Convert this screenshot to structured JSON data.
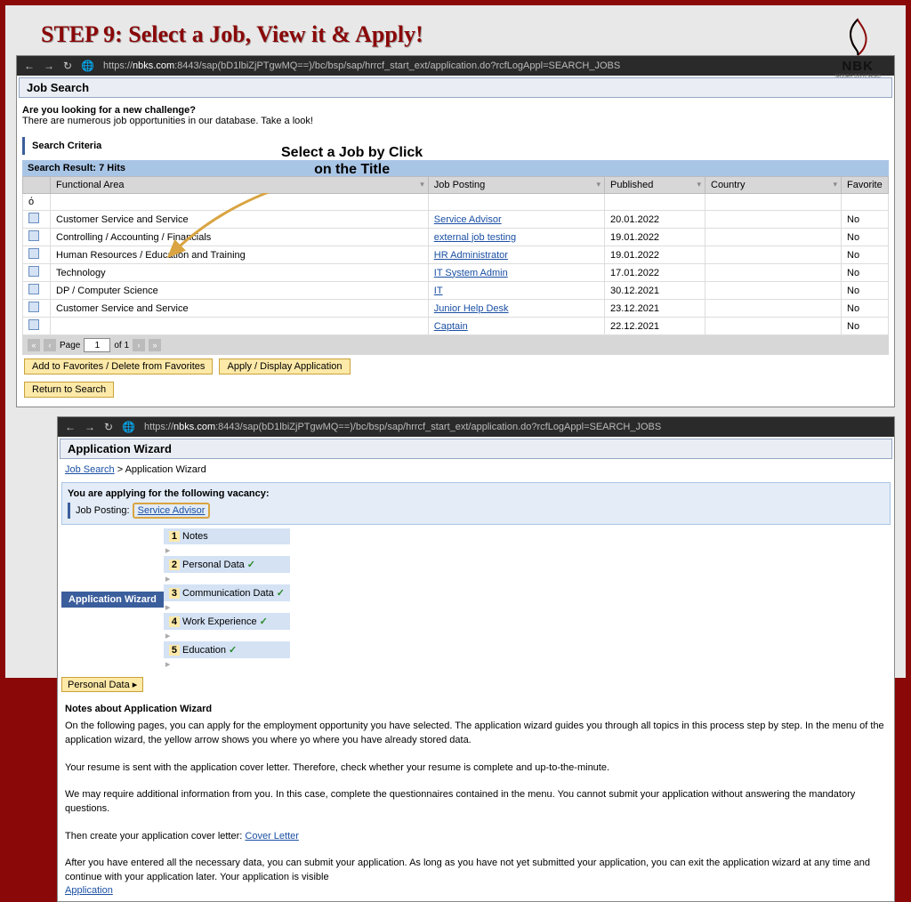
{
  "title": "STEP 9: Select a Job, View it & Apply!",
  "logo": {
    "text": "NBK",
    "sub": "NASSER BIN KHALED"
  },
  "annot": {
    "line1": "Select a Job by Click",
    "line2": "on the Title"
  },
  "browser": {
    "url_pre": "https://",
    "url_dom": "nbks.com",
    "url_post": ":8443/sap(bD1lbiZjPTgwMQ==)/bc/bsp/sap/hrrcf_start_ext/application.do?rcfLogAppl=SEARCH_JOBS"
  },
  "search": {
    "title": "Job Search",
    "q": "Are you looking for a new challenge?",
    "sub": "There are numerous job opportunities in our database. Take a look!",
    "criteria": "Search Criteria",
    "result": "Search Result: 7 Hits",
    "cols": {
      "fa": "Functional Area",
      "jp": "Job Posting",
      "pub": "Published",
      "cty": "Country",
      "fav": "Favorite"
    },
    "rows": [
      {
        "fa": "Customer Service and Service",
        "jp": "Service Advisor",
        "pub": "20.01.2022",
        "cty": "",
        "fav": "No"
      },
      {
        "fa": "Controlling / Accounting / Financials",
        "jp": "external job testing",
        "pub": "19.01.2022",
        "cty": "",
        "fav": "No"
      },
      {
        "fa": "Human Resources / Education and Training",
        "jp": "HR Administrator",
        "pub": "19.01.2022",
        "cty": "",
        "fav": "No"
      },
      {
        "fa": "Technology",
        "jp": "IT System Admin",
        "pub": "17.01.2022",
        "cty": "",
        "fav": "No"
      },
      {
        "fa": "DP / Computer Science",
        "jp": "IT",
        "pub": "30.12.2021",
        "cty": "",
        "fav": "No"
      },
      {
        "fa": "Customer Service and Service",
        "jp": "Junior Help Desk",
        "pub": "23.12.2021",
        "cty": "",
        "fav": "No"
      },
      {
        "fa": "",
        "jp": "Captain",
        "pub": "22.12.2021",
        "cty": "",
        "fav": "No"
      }
    ],
    "pager": {
      "label": "Page",
      "of": "of 1",
      "val": "1"
    },
    "btn_fav": "Add to Favorites / Delete from Favorites",
    "btn_apply": "Apply / Display Application",
    "btn_return": "Return to Search"
  },
  "wiz": {
    "title": "Application Wizard",
    "crumb_a": "Job Search",
    "crumb_b": "Application Wizard",
    "vac_head": "You are applying for the following vacancy:",
    "post_lbl": "Job Posting:",
    "post_val": "Service Advisor",
    "tab": "Application Wizard",
    "steps": [
      {
        "n": "1",
        "t": "Notes"
      },
      {
        "n": "2",
        "t": "Personal Data"
      },
      {
        "n": "3",
        "t": "Communication Data"
      },
      {
        "n": "4",
        "t": "Work Experience"
      },
      {
        "n": "5",
        "t": "Education"
      }
    ],
    "pd": "Personal Data",
    "notes_h": "Notes about Application Wizard",
    "p1": "On the following pages, you can apply for the employment opportunity you have selected. The application wizard guides you through all topics in this process step by step. In the menu of the application wizard, the yellow arrow shows you where yo where you have already stored data.",
    "p2": "Your resume is sent with the application cover letter. Therefore, check whether your resume is complete and up-to-the-minute.",
    "p3": "We may require additional information from you. In this case, complete the questionnaires contained in the menu. You cannot submit your application without answering the mandatory questions.",
    "p4a": "Then create your application cover letter: ",
    "p4b": "Cover Letter",
    "p5a": "After you have entered all the necessary data, you can submit your application. As long as you have not yet submitted your application, you can exit the application wizard at any time and continue with your application later. Your application is visible ",
    "p5b": "Application"
  }
}
